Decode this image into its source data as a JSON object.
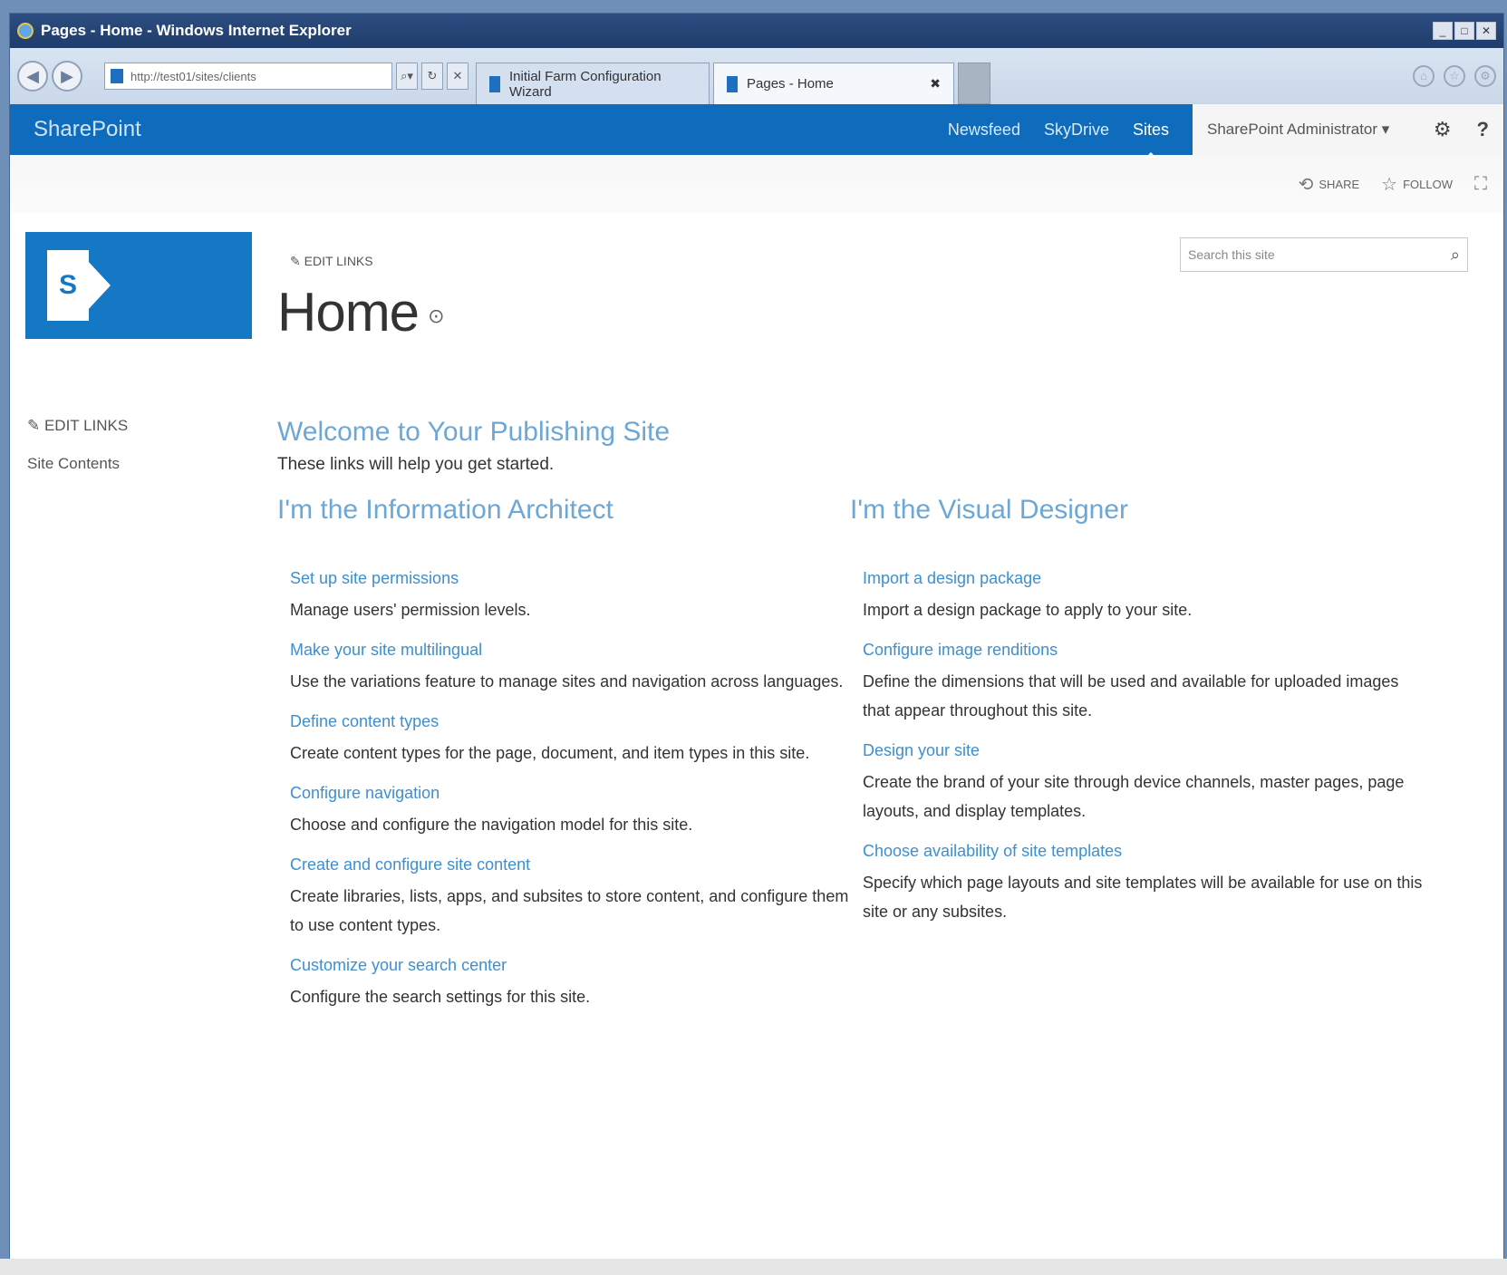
{
  "window": {
    "title": "Pages - Home - Windows Internet Explorer",
    "minimize": "_",
    "restore": "□",
    "close": "✕"
  },
  "browser": {
    "back": "◀",
    "forward": "▶",
    "address": "http://test01/sites/clients",
    "search_btn": "⌕▾",
    "refresh_btn": "↻",
    "stop_btn": "✕",
    "tabs": [
      {
        "label": "Initial Farm Configuration Wizard"
      },
      {
        "label": "Pages - Home",
        "close": "✖"
      }
    ],
    "home_icon": "⌂",
    "favorites_icon": "☆",
    "tools_icon": "⚙"
  },
  "suitebar": {
    "brand": "SharePoint",
    "links": [
      "Newsfeed",
      "SkyDrive",
      "Sites"
    ],
    "user": "SharePoint Administrator ▾",
    "gear": "⚙",
    "help": "?"
  },
  "actions": {
    "share": "SHARE",
    "follow": "FOLLOW",
    "share_icon": "⟲",
    "follow_icon": "☆",
    "focus_icon": "⛶"
  },
  "header": {
    "edit_links": "✎  EDIT LINKS",
    "title": "Home",
    "title_icon": "⊙",
    "search_placeholder": "Search this site",
    "search_icon": "⌕",
    "logo_letter": "S"
  },
  "leftnav": {
    "edit_links": "✎  EDIT LINKS",
    "site_contents": "Site Contents"
  },
  "main": {
    "welcome": "Welcome to Your Publishing Site",
    "intro": "These links will help you get started.",
    "columns": [
      {
        "title": "I'm the Information Architect",
        "items": [
          {
            "link": "Set up site permissions",
            "desc": "Manage users' permission levels."
          },
          {
            "link": "Make your site multilingual",
            "desc": "Use the variations feature to manage sites and navigation across languages."
          },
          {
            "link": "Define content types",
            "desc": "Create content types for the page, document, and item types in this site."
          },
          {
            "link": "Configure navigation",
            "desc": "Choose and configure the navigation model for this site."
          },
          {
            "link": "Create and configure site content",
            "desc": "Create libraries, lists, apps, and subsites to store content, and configure them to use content types."
          },
          {
            "link": "Customize your search center",
            "desc": "Configure the search settings for this site."
          }
        ]
      },
      {
        "title": "I'm the Visual Designer",
        "items": [
          {
            "link": "Import a design package",
            "desc": "Import a design package to apply to your site."
          },
          {
            "link": "Configure image renditions",
            "desc": "Define the dimensions that will be used and available for uploaded images that appear throughout this site."
          },
          {
            "link": "Design your site",
            "desc": "Create the brand of your site through device channels, master pages, page layouts, and display templates."
          },
          {
            "link": "Choose availability of site templates",
            "desc": "Specify which page layouts and site templates will be available for use on this site or any subsites."
          }
        ]
      }
    ]
  }
}
